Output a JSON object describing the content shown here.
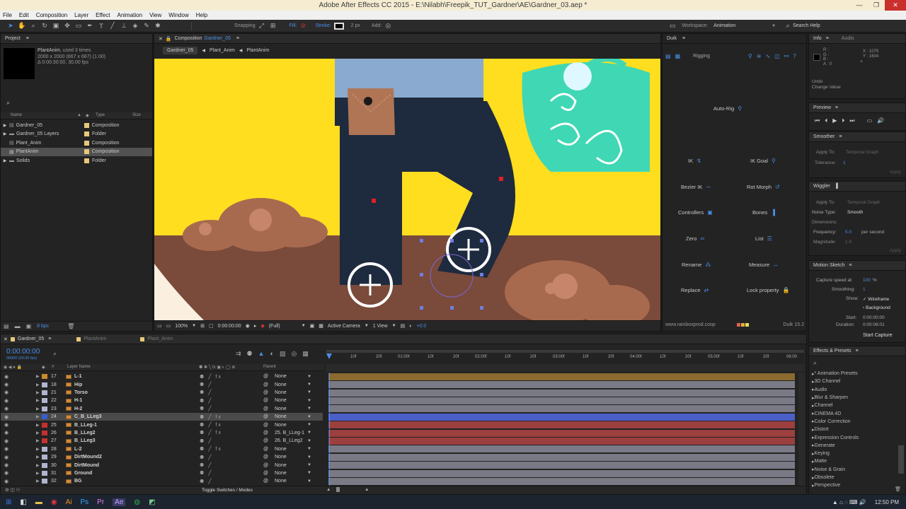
{
  "window": {
    "title": "Adobe After Effects CC 2015 - E:\\Nilabh\\Freepik_TUT_Gardner\\AE\\Gardner_03.aep *"
  },
  "menu": [
    "File",
    "Edit",
    "Composition",
    "Layer",
    "Effect",
    "Animation",
    "View",
    "Window",
    "Help"
  ],
  "toolbar": {
    "snapping": "Snapping",
    "fill": "Fill:",
    "stroke": "Stroke:",
    "stroke_width": "2 px",
    "add": "Add:",
    "workspace_label": "Workspace:",
    "workspace_value": "Animation",
    "search_help": "Search Help"
  },
  "project": {
    "tab": "Project",
    "selected_name": "PlantAnim",
    "used": ", used 3 times",
    "dims": "2000 x 2000 (667 x 667) (1.00)",
    "duration": "Δ 0:00:30:00, 30.00 fps",
    "col_name": "Name",
    "col_type": "Type",
    "col_size": "Size",
    "items": [
      {
        "name": "Gardner_05",
        "type": "Composition",
        "color": "#e6c97a"
      },
      {
        "name": "Gardner_05 Layers",
        "type": "Folder",
        "color": "#e6c97a"
      },
      {
        "name": "Plant_Anim",
        "type": "Composition",
        "color": "#e6c97a"
      },
      {
        "name": "PlantAnim",
        "type": "Composition",
        "color": "#e6c97a"
      },
      {
        "name": "Solids",
        "type": "Folder",
        "color": "#e6c97a"
      }
    ],
    "bpc": "8 bpc"
  },
  "composition": {
    "tab_prefix": "Composition",
    "tab_name": "Gardner_05",
    "crumbs": [
      "Gardner_05",
      "Plant_Anim",
      "PlantAnim"
    ],
    "zoom": "100%",
    "timecode": "0:00:00:00",
    "resolution": "(Full)",
    "camera": "Active Camera",
    "views": "1 View",
    "exposure": "+0.0"
  },
  "duik": {
    "tab": "Duik",
    "rigging": "Rigging",
    "buttons": {
      "auto_rig": "Auto-Rig",
      "ik": "IK",
      "ik_goal": "IK Goal",
      "bezier_ik": "Bezier IK",
      "rot_morph": "Rot Morph",
      "controllers": "Controllers",
      "bones": "Bones",
      "zero": "Zero",
      "list": "List",
      "rename": "Rename",
      "measure": "Measure",
      "replace": "Replace",
      "lock_property": "Lock property"
    },
    "footer_url": "www.rainboxprod.coop",
    "version": "Duik 15.2"
  },
  "info": {
    "tab": "Info",
    "tab2": "Audio",
    "rgba": [
      "R :",
      "G :",
      "B :",
      "A : 0"
    ],
    "coords": [
      "X : 1075",
      "Y : 1604"
    ],
    "undo": "Undo",
    "change_value": "Change Value"
  },
  "preview": {
    "tab": "Preview"
  },
  "smoother": {
    "tab": "Smoother",
    "apply_to": "Apply To:",
    "apply_value": "Temporal Graph",
    "tolerance": "Tolerance:",
    "tolerance_value": "1",
    "apply": "Apply"
  },
  "wiggler": {
    "tab": "Wiggler",
    "apply_to": "Apply To:",
    "apply_value": "Temporal Graph",
    "noise": "Noise Type:",
    "noise_value": "Smooth",
    "dimensions": "Dimensions:",
    "frequency": "Frequency:",
    "frequency_value": "5.0",
    "per_second": "per second",
    "magnitude": "Magnitude:",
    "magnitude_value": "1.0",
    "apply": "Apply"
  },
  "motion_sketch": {
    "tab": "Motion Sketch",
    "capture": "Capture speed at:",
    "capture_value": "100",
    "percent": "%",
    "smoothing": "Smoothing:",
    "smoothing_value": "1",
    "show": "Show:",
    "wireframe": "Wireframe",
    "background": "Background",
    "start": "Start:",
    "start_value": "0:00:00:00",
    "duration": "Duration:",
    "duration_value": "0:00:06:01",
    "start_capture": "Start Capture"
  },
  "effects": {
    "tab": "Effects & Presets",
    "items": [
      "* Animation Presets",
      "3D Channel",
      "Audio",
      "Blur & Sharpen",
      "Channel",
      "CINEMA 4D",
      "Color Correction",
      "Distort",
      "Expression Controls",
      "Generate",
      "Keying",
      "Matte",
      "Noise & Grain",
      "Obsolete",
      "Perspective"
    ]
  },
  "timeline": {
    "tabs": [
      "Gardner_05",
      "PlantAnim",
      "Plant_Anim"
    ],
    "timecode": "0:00:00:00",
    "fps": "00000 (30.00 fps)",
    "col_layer": "Layer Name",
    "col_parent": "Parent",
    "col_num": "#",
    "ruler": [
      "10f",
      "20f",
      "01:00f",
      "10f",
      "20f",
      "02:00f",
      "10f",
      "20f",
      "03:00f",
      "10f",
      "20f",
      "04:00f",
      "10f",
      "20f",
      "05:00f",
      "10f",
      "20f",
      "06:00"
    ],
    "toggle": "Toggle Switches / Modes",
    "layers": [
      {
        "num": "17",
        "name": "L-1",
        "parent": "None",
        "label": "#c98a2e",
        "bar": "#8a6a2e",
        "fx": true
      },
      {
        "num": "18",
        "name": "Hip",
        "parent": "None",
        "label": "#b0b4d0",
        "bar": "#7a7a86",
        "fx": false
      },
      {
        "num": "21",
        "name": "Torso",
        "parent": "None",
        "label": "#b0b4d0",
        "bar": "#7a7a86",
        "fx": false
      },
      {
        "num": "22",
        "name": "H-1",
        "parent": "None",
        "label": "#b0b4d0",
        "bar": "#7a7a86",
        "fx": false
      },
      {
        "num": "23",
        "name": "H-2",
        "parent": "None",
        "label": "#b0b4d0",
        "bar": "#7a7a86",
        "fx": false
      },
      {
        "num": "24",
        "name": "C_B_LLeg3",
        "parent": "None",
        "label": "#3a5ccf",
        "bar": "#4c5fc7",
        "fx": true,
        "selected": true
      },
      {
        "num": "25",
        "name": "B_LLeg-1",
        "parent": "None",
        "label": "#c43030",
        "bar": "#9c3f3f",
        "fx": true
      },
      {
        "num": "26",
        "name": "B_LLeg2",
        "parent": "25. B_LLeg-1",
        "label": "#c43030",
        "bar": "#9c3f3f",
        "fx": true
      },
      {
        "num": "27",
        "name": "B_LLeg3",
        "parent": "26. B_LLeg2",
        "label": "#c43030",
        "bar": "#9c3f3f",
        "fx": false
      },
      {
        "num": "28",
        "name": "L-2",
        "parent": "None",
        "label": "#b0b4d0",
        "bar": "#7a7a86",
        "fx": true
      },
      {
        "num": "29",
        "name": "DirtMound2",
        "parent": "None",
        "label": "#b0b4d0",
        "bar": "#7a7a86",
        "fx": false
      },
      {
        "num": "30",
        "name": "DirtMound",
        "parent": "None",
        "label": "#b0b4d0",
        "bar": "#7a7a86",
        "fx": false
      },
      {
        "num": "31",
        "name": "Ground",
        "parent": "None",
        "label": "#b0b4d0",
        "bar": "#7a7a86",
        "fx": false
      },
      {
        "num": "32",
        "name": "BG",
        "parent": "None",
        "label": "#b0b4d0",
        "bar": "#7a7a86",
        "fx": false
      }
    ]
  },
  "taskbar": {
    "clock": "12:50 PM"
  },
  "colors": {
    "sky": "#ffde20",
    "ground": "#7a4a3a",
    "accent": "#4a8ee6"
  }
}
